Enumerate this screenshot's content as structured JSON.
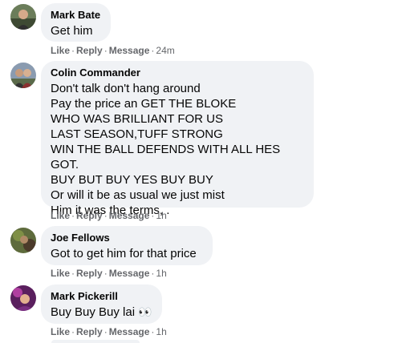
{
  "actions": {
    "like": "Like",
    "reply": "Reply",
    "message": "Message",
    "sep": "·"
  },
  "comments": [
    {
      "author": "Mark Bate",
      "text": "Get him",
      "time": "24m",
      "avatar_icon": "profile-photo"
    },
    {
      "author": "Colin Commander",
      "text": "Don't talk don't hang around\nPay the price an GET THE BLOKE\nWHO WAS BRILLIANT FOR US\nLAST SEASON,TUFF STRONG\nWIN THE BALL DEFENDS WITH ALL HES GOT.\nBUY BUT BUY YES BUY BUY\nOr will it be as usual we just mist\nHim it was the terms, .",
      "time": "1h",
      "avatar_icon": "profile-photo"
    },
    {
      "author": "Joe Fellows",
      "text": "Got to get him for that price",
      "time": "1h",
      "avatar_icon": "profile-photo"
    },
    {
      "author": "Mark Pickerill",
      "text": "Buy Buy Buy lai",
      "emoji": "👀",
      "time": "1h",
      "avatar_icon": "profile-photo"
    }
  ],
  "colors": {
    "bubble": "#f0f2f5",
    "secondary_text": "#65676b",
    "primary_text": "#050505"
  }
}
